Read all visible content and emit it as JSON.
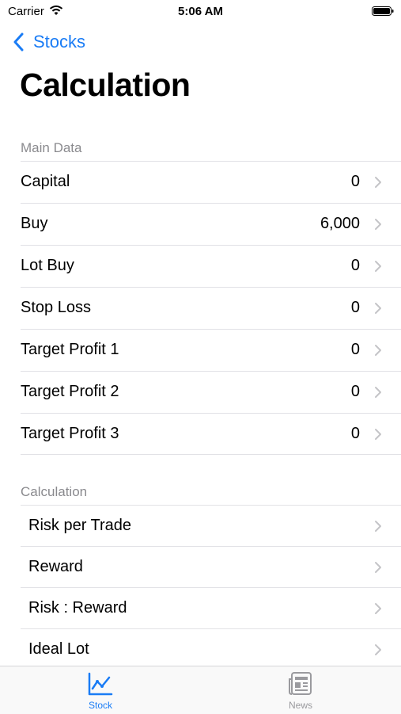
{
  "status_bar": {
    "carrier": "Carrier",
    "time": "5:06 AM"
  },
  "nav": {
    "back_label": "Stocks",
    "title": "Calculation"
  },
  "sections": {
    "main_data": {
      "header": "Main Data",
      "rows": [
        {
          "label": "Capital",
          "value": "0"
        },
        {
          "label": "Buy",
          "value": "6,000"
        },
        {
          "label": "Lot Buy",
          "value": "0"
        },
        {
          "label": "Stop Loss",
          "value": "0"
        },
        {
          "label": "Target Profit 1",
          "value": "0"
        },
        {
          "label": "Target Profit 2",
          "value": "0"
        },
        {
          "label": "Target Profit 3",
          "value": "0"
        }
      ]
    },
    "calculation": {
      "header": "Calculation",
      "rows": [
        {
          "label": "Risk per Trade"
        },
        {
          "label": "Reward"
        },
        {
          "label": "Risk : Reward"
        },
        {
          "label": "Ideal Lot"
        }
      ]
    }
  },
  "tab_bar": {
    "tabs": [
      {
        "label": "Stock",
        "icon": "chart-icon",
        "selected": true
      },
      {
        "label": "News",
        "icon": "newspaper-icon",
        "selected": false
      }
    ]
  },
  "colors": {
    "accent": "#1a7cf5",
    "secondary_text": "#8a8a8e",
    "separator": "#e2e2e6"
  }
}
